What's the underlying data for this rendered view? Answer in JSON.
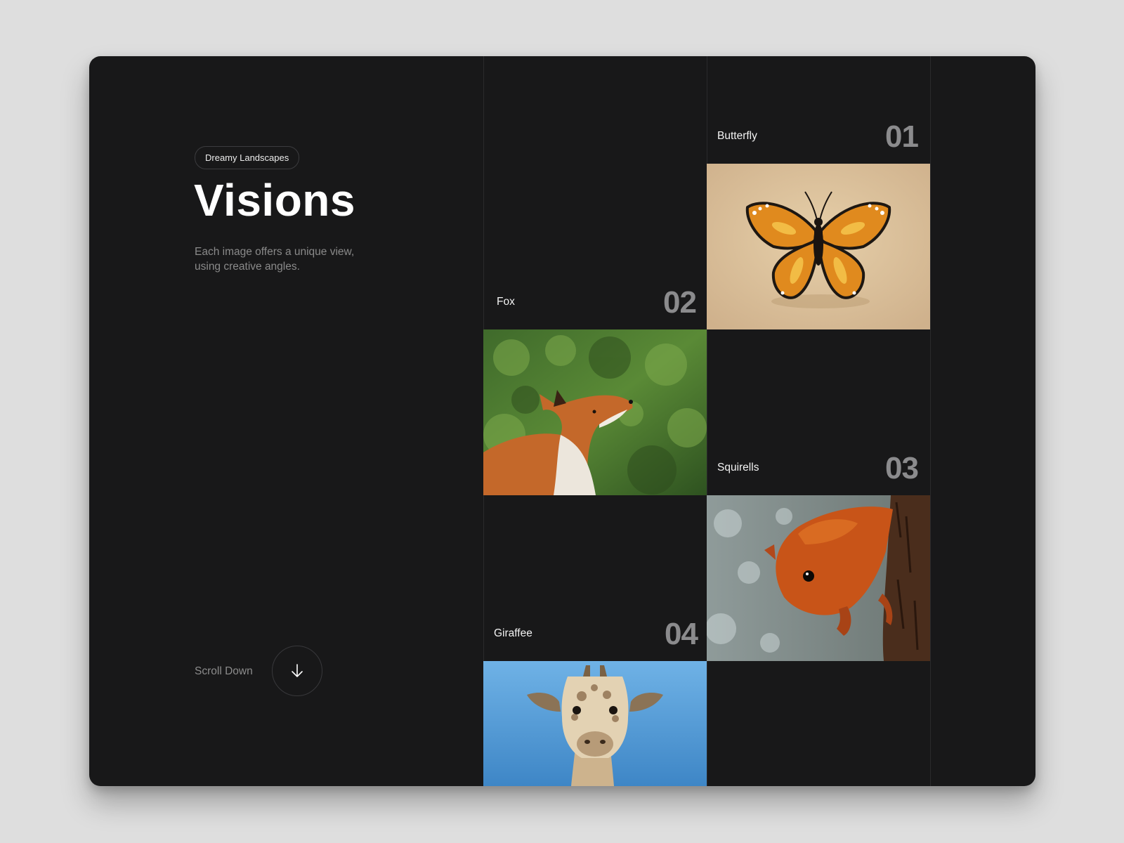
{
  "hero": {
    "badge": "Dreamy Landscapes",
    "title": "Visions",
    "subtitle": "Each image offers a unique view, using creative angles."
  },
  "scroll": {
    "label": "Scroll Down",
    "icon": "arrow-down-icon"
  },
  "gallery": [
    {
      "name": "Butterfly",
      "number": "01"
    },
    {
      "name": "Fox",
      "number": "02"
    },
    {
      "name": "Squirells",
      "number": "03"
    },
    {
      "name": "Giraffee",
      "number": "04"
    }
  ],
  "colors": {
    "background": "#dedede",
    "card": "#181819",
    "number": "#8b8b8d"
  }
}
